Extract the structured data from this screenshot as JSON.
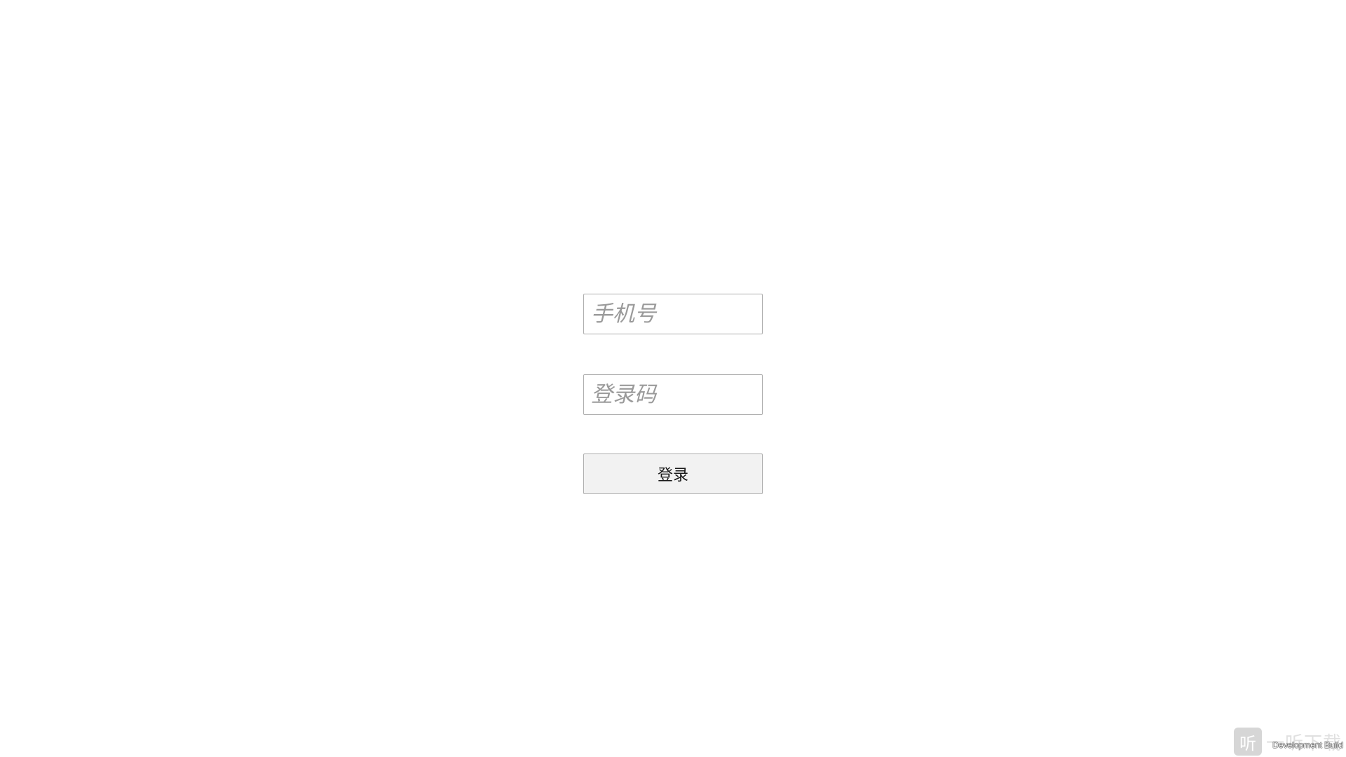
{
  "login": {
    "phone_placeholder": "手机号",
    "phone_value": "",
    "code_placeholder": "登录码",
    "code_value": "",
    "submit_label": "登录"
  },
  "watermark": {
    "logo_glyph": "听",
    "text": "一听下载"
  },
  "build_label": "Development Build",
  "colors": {
    "background": "#ffffff",
    "input_border": "#adadad",
    "placeholder": "#9a9a9a",
    "button_background": "#f2f2f2"
  }
}
